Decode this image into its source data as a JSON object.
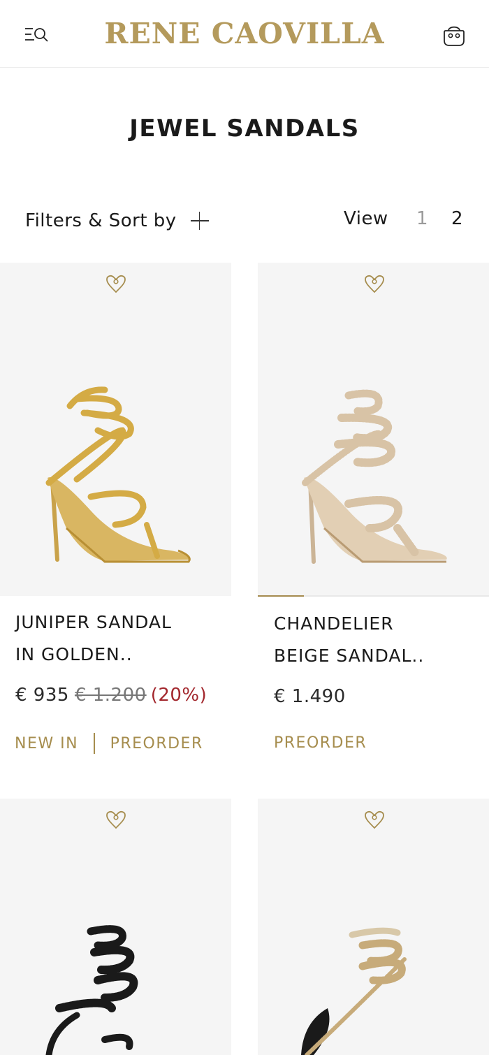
{
  "header": {
    "brand": "RENE CAOVILLA",
    "accent_color": "#b49a5c",
    "menu_icon": "menu-search-icon",
    "bag_icon": "shopping-bag-icon"
  },
  "page": {
    "title": "JEWEL SANDALS"
  },
  "toolbar": {
    "filters_label": "Filters & Sort by",
    "view_label": "View",
    "view_options": [
      "1",
      "2"
    ],
    "view_selected": "2"
  },
  "products": [
    {
      "name_line1": "JUNIPER SANDAL",
      "name_line2": "IN GOLDEN..",
      "price": "€ 935",
      "old_price": "€ 1.200",
      "discount": "(20%)",
      "tags": [
        "NEW IN",
        "PREORDER"
      ],
      "shoe_color": "#d4ab45"
    },
    {
      "name_line1": "CHANDELIER",
      "name_line2": "BEIGE SANDAL..",
      "price": "€ 1.490",
      "tags": [
        "PREORDER"
      ],
      "shoe_color": "#d8c3a6",
      "carousel_progress": 0.2
    },
    {
      "shoe_color": "#1a1a1a"
    },
    {
      "shoe_color": "#c7ab7a"
    }
  ]
}
